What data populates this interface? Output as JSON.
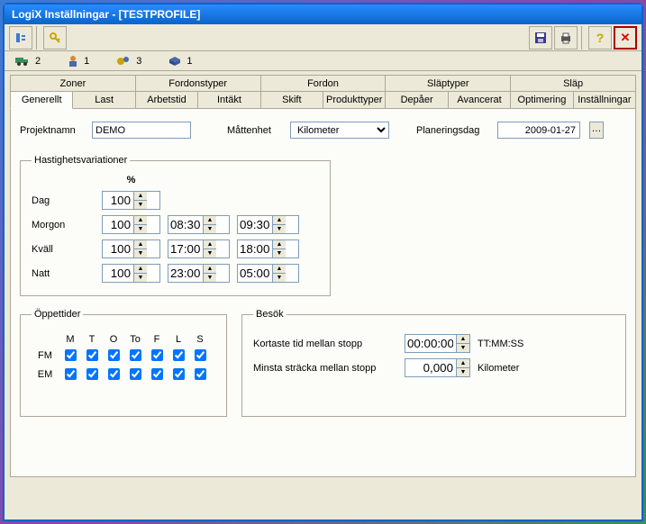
{
  "title": "LogiX Inställningar - [TESTPROFILE]",
  "status_counts": {
    "a": "2",
    "b": "1",
    "c": "3",
    "d": "1"
  },
  "tabs_row1": [
    "Zoner",
    "Fordonstyper",
    "Fordon",
    "Släptyper",
    "Släp"
  ],
  "tabs_row2": [
    "Generellt",
    "Last",
    "Arbetstid",
    "Intäkt",
    "Skift",
    "Produkttyper",
    "Depåer",
    "Avancerat",
    "Optimering",
    "Inställningar"
  ],
  "labels": {
    "projektnamn": "Projektnamn",
    "mattenhet": "Måttenhet",
    "planeringsdag": "Planeringsdag",
    "hastighet": "Hastighetsvariationer",
    "percent": "%",
    "dag": "Dag",
    "morgon": "Morgon",
    "kvall": "Kväll",
    "natt": "Natt",
    "oppettider": "Öppettider",
    "fm": "FM",
    "em": "EM",
    "besok": "Besök",
    "kortaste": "Kortaste tid mellan stopp",
    "minsta": "Minsta sträcka mellan stopp",
    "ttmmss": "TT:MM:SS",
    "kilometer": "Kilometer"
  },
  "project_name": "DEMO",
  "unit": "Kilometer",
  "plan_date": "2009-01-27",
  "speed": {
    "dag": {
      "pct": "100"
    },
    "morgon": {
      "pct": "100",
      "from": "08:30",
      "to": "09:30"
    },
    "kvall": {
      "pct": "100",
      "from": "17:00",
      "to": "18:00"
    },
    "natt": {
      "pct": "100",
      "from": "23:00",
      "to": "05:00"
    }
  },
  "days": [
    "M",
    "T",
    "O",
    "To",
    "F",
    "L",
    "S"
  ],
  "open_fm": [
    true,
    true,
    true,
    true,
    true,
    true,
    true
  ],
  "open_em": [
    true,
    true,
    true,
    true,
    true,
    true,
    true
  ],
  "besok": {
    "min_time": "00:00:00",
    "min_dist": "0,000"
  }
}
